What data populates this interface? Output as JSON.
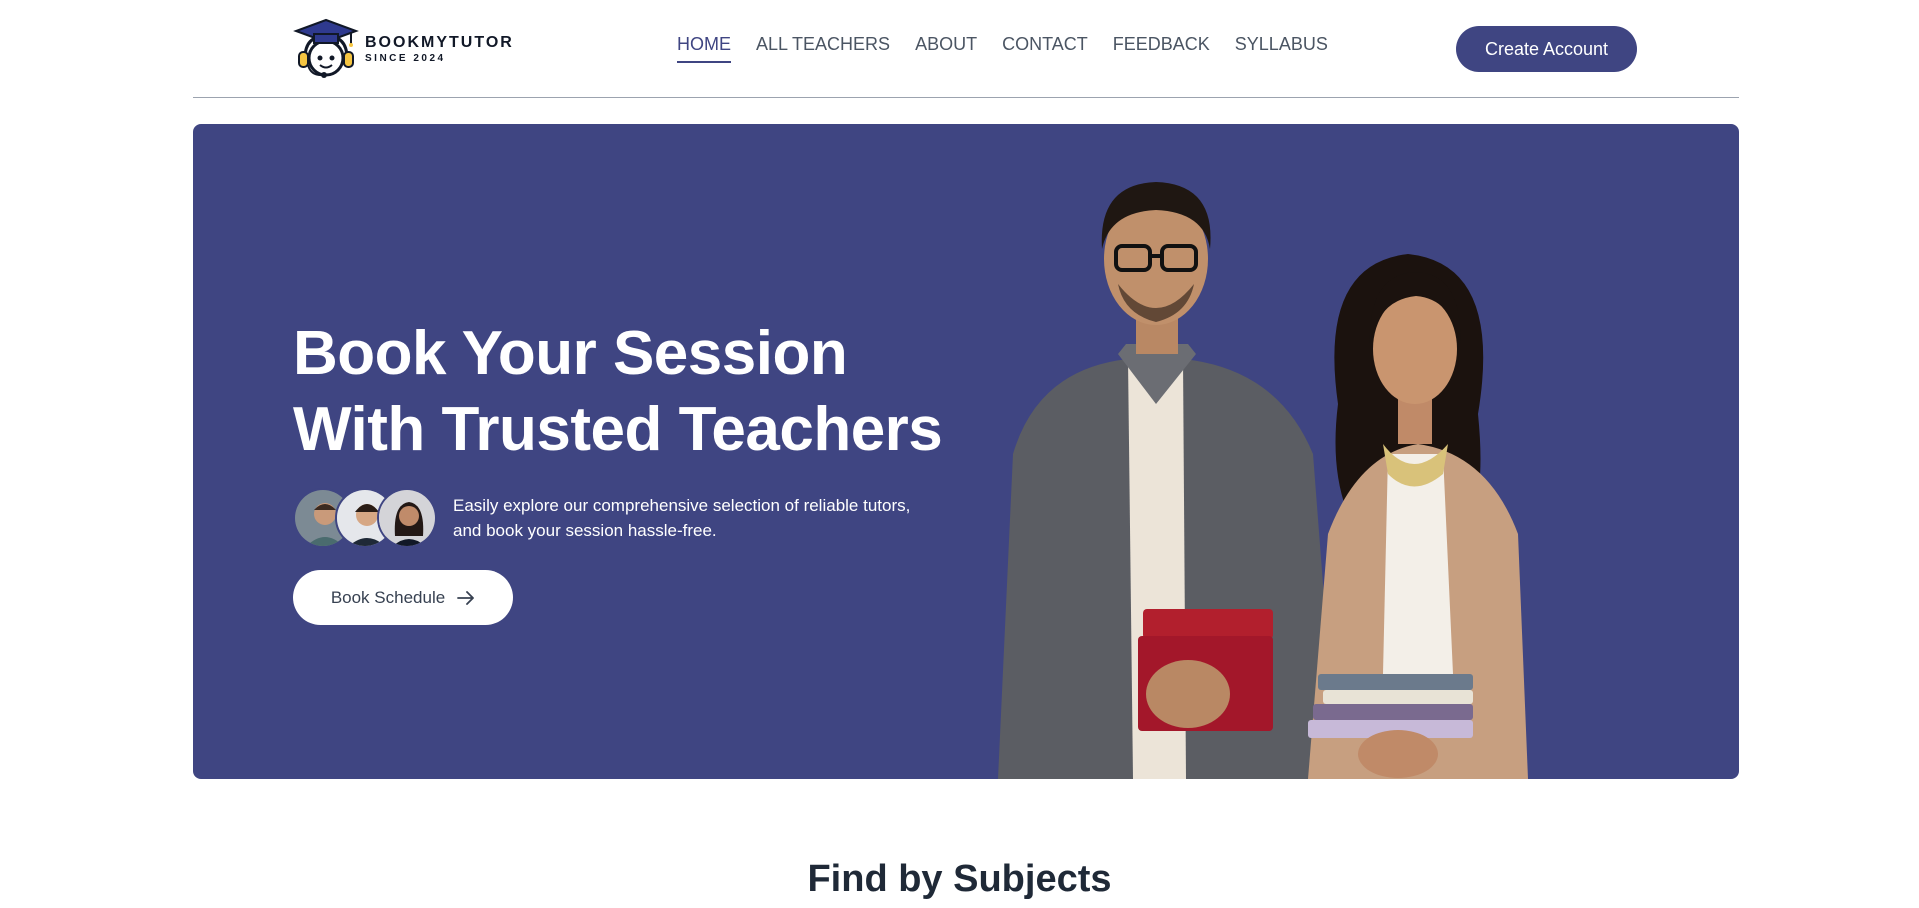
{
  "brand": {
    "name": "BOOKMYTUTOR",
    "since": "SINCE 2024",
    "logo_icon": "graduation-cap-mascot"
  },
  "nav": {
    "items": [
      {
        "label": "HOME",
        "active": true
      },
      {
        "label": "ALL TEACHERS",
        "active": false
      },
      {
        "label": "ABOUT",
        "active": false
      },
      {
        "label": "CONTACT",
        "active": false
      },
      {
        "label": "FEEDBACK",
        "active": false
      },
      {
        "label": "SYLLABUS",
        "active": false
      }
    ],
    "cta": "Create Account"
  },
  "hero": {
    "title_line1": "Book Your Session",
    "title_line2": "With Trusted Teachers",
    "desc_line1": "Easily explore our comprehensive selection of reliable tutors,",
    "desc_line2": "and book your session hassle-free.",
    "button": "Book Schedule",
    "button_icon": "arrow-right-icon"
  },
  "section": {
    "title": "Find by Subjects"
  },
  "colors": {
    "primary": "#3f4582",
    "text": "#1f2937",
    "nav_text": "#4b5563",
    "white": "#ffffff"
  }
}
